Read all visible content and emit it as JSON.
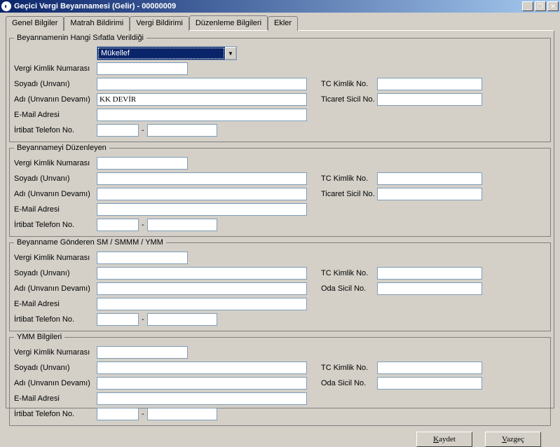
{
  "window": {
    "title": "Geçici Vergi Beyannamesi (Gelir) - 00000009",
    "min": "_",
    "restore": "❐",
    "close": "✕"
  },
  "tabs": {
    "t0": "Genel Bilgiler",
    "t1": "Matrah Bildirimi",
    "t2": "Vergi Bildirimi",
    "t3": "Düzenleme Bilgileri",
    "t4": "Ekler"
  },
  "groups": {
    "g1": "Beyannamenin Hangi Sıfatla Verildiği",
    "g2": "Beyannameyi Düzenleyen",
    "g3": "Beyanname Gönderen SM / SMMM / YMM",
    "g4": "YMM Bilgileri"
  },
  "labels": {
    "vkn": "Vergi Kimlik Numarası",
    "soyadi": "Soyadı (Unvanı)",
    "adi": "Adı (Unvanın Devamı)",
    "email": "E-Mail Adresi",
    "tel": "İrtibat Telefon No.",
    "tckn": "TC Kimlik No.",
    "ticaret": "Ticaret Sicil No.",
    "oda": "Oda Sicil No."
  },
  "dropdown": {
    "selected": "Mükellef"
  },
  "values": {
    "g1": {
      "vkn": "",
      "soyadi": "",
      "adi": "KK DEVİR",
      "tckn": "",
      "ticaret": "",
      "email": "",
      "tel1": "",
      "tel2": ""
    },
    "g2": {
      "vkn": "",
      "soyadi": "",
      "adi": "",
      "tckn": "",
      "ticaret": "",
      "email": "",
      "tel1": "",
      "tel2": ""
    },
    "g3": {
      "vkn": "",
      "soyadi": "",
      "adi": "",
      "tckn": "",
      "oda": "",
      "email": "",
      "tel1": "",
      "tel2": ""
    },
    "g4": {
      "vkn": "",
      "soyadi": "",
      "adi": "",
      "tckn": "",
      "oda": "",
      "email": "",
      "tel1": "",
      "tel2": ""
    }
  },
  "buttons": {
    "save_pre": "K",
    "save_post": "aydet",
    "cancel_pre": "V",
    "cancel_post": "azgeç"
  }
}
